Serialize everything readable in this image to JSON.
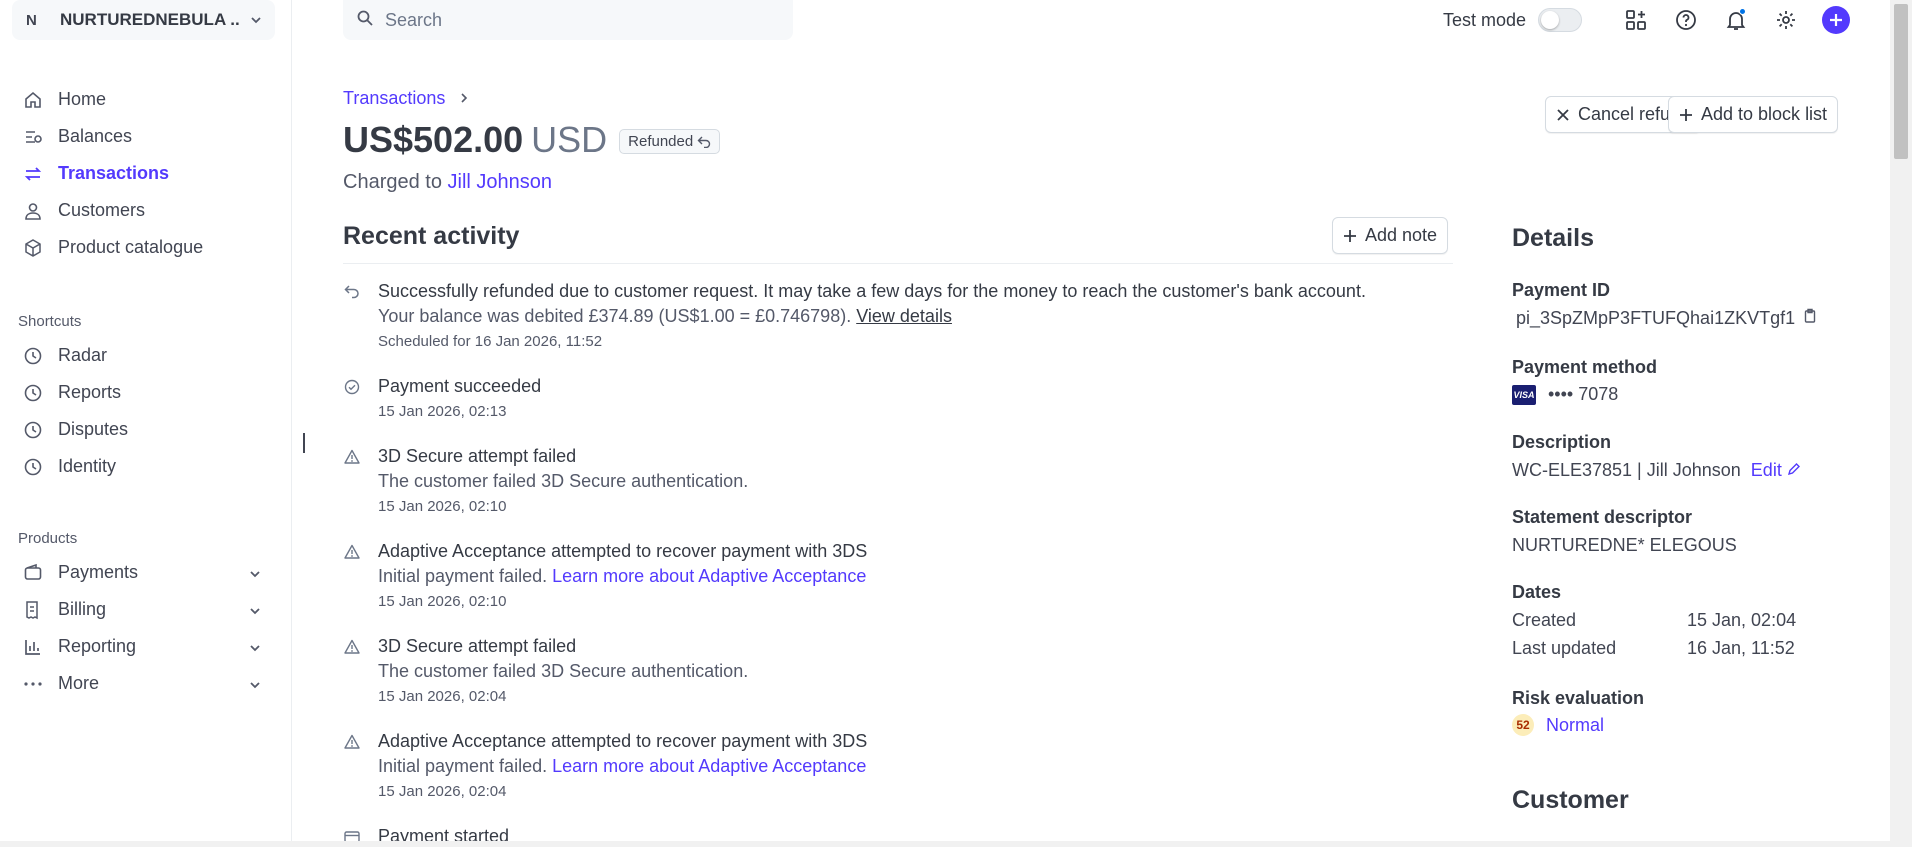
{
  "account": {
    "initial": "N",
    "name": "NURTUREDNEBULA ..."
  },
  "sidebar": {
    "items": [
      {
        "label": "Home",
        "icon": "home-icon"
      },
      {
        "label": "Balances",
        "icon": "balances-icon"
      },
      {
        "label": "Transactions",
        "icon": "transactions-icon",
        "active": true
      },
      {
        "label": "Customers",
        "icon": "customers-icon"
      },
      {
        "label": "Product catalogue",
        "icon": "product-icon"
      }
    ],
    "shortcuts_title": "Shortcuts",
    "shortcuts": [
      {
        "label": "Radar",
        "icon": "clock-icon"
      },
      {
        "label": "Reports",
        "icon": "clock-icon"
      },
      {
        "label": "Disputes",
        "icon": "clock-icon"
      },
      {
        "label": "Identity",
        "icon": "clock-icon"
      }
    ],
    "products_title": "Products",
    "products": [
      {
        "label": "Payments",
        "icon": "wallet-icon"
      },
      {
        "label": "Billing",
        "icon": "billing-icon"
      },
      {
        "label": "Reporting",
        "icon": "bar-chart-icon"
      },
      {
        "label": "More",
        "icon": "more-icon"
      }
    ]
  },
  "search": {
    "placeholder": "Search"
  },
  "topbar": {
    "test_mode_label": "Test mode"
  },
  "header": {
    "breadcrumb": "Transactions",
    "amount": "US$502.00",
    "currency": "USD",
    "status": "Refunded",
    "charged_prefix": "Charged to",
    "customer_name": "Jill Johnson",
    "cancel_refund": "Cancel refund",
    "add_block": "Add to block list"
  },
  "activity": {
    "title": "Recent activity",
    "add_note": "Add note",
    "events": [
      {
        "title": "Successfully refunded due to customer request. It may take a few days for the money to reach the customer's bank account.",
        "line_prefix": "Your balance was debited £374.89 (US$1.00 = £0.746798).",
        "line_link": "View details",
        "timestamp": "Scheduled for 16 Jan 2026, 11:52",
        "icon": "refund-icon"
      },
      {
        "title": "Payment succeeded",
        "timestamp": "15 Jan 2026, 02:13",
        "icon": "check-circle-icon"
      },
      {
        "title": "3D Secure attempt failed",
        "line": "The customer failed 3D Secure authentication.",
        "timestamp": "15 Jan 2026, 02:10",
        "icon": "warning-icon"
      },
      {
        "title": "Adaptive Acceptance attempted to recover payment with 3DS",
        "line_prefix": "Initial payment failed.",
        "line_link": "Learn more about Adaptive Acceptance",
        "timestamp": "15 Jan 2026, 02:10",
        "icon": "warning-icon"
      },
      {
        "title": "3D Secure attempt failed",
        "line": "The customer failed 3D Secure authentication.",
        "timestamp": "15 Jan 2026, 02:04",
        "icon": "warning-icon"
      },
      {
        "title": "Adaptive Acceptance attempted to recover payment with 3DS",
        "line_prefix": "Initial payment failed.",
        "line_link": "Learn more about Adaptive Acceptance",
        "timestamp": "15 Jan 2026, 02:04",
        "icon": "warning-icon"
      },
      {
        "title": "Payment started",
        "icon": "card-icon"
      }
    ]
  },
  "details": {
    "title": "Details",
    "payment_id_label": "Payment ID",
    "payment_id": "pi_3SpZMpP3FTUFQhai1ZKVTgf1",
    "payment_method_label": "Payment method",
    "card_brand": "VISA",
    "card_last4": "•••• 7078",
    "description_label": "Description",
    "description": "WC-ELE37851 | Jill Johnson",
    "edit_label": "Edit",
    "statement_label": "Statement descriptor",
    "statement": "NURTUREDNE* ELEGOUS",
    "dates_label": "Dates",
    "created_label": "Created",
    "created": "15 Jan, 02:04",
    "updated_label": "Last updated",
    "updated": "16 Jan, 11:52",
    "risk_label": "Risk evaluation",
    "risk_score": "52",
    "risk_level": "Normal",
    "customer_title": "Customer"
  },
  "colors": {
    "accent": "#533afd",
    "text": "#414552",
    "muted": "#545969"
  }
}
